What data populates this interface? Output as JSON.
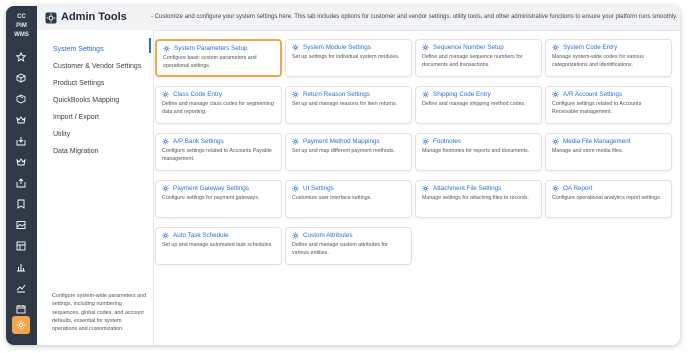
{
  "rail": {
    "brand_lines": [
      "CC",
      "PIM",
      "WMS"
    ],
    "accent_color": "#f2a64a",
    "icons": [
      "star-icon",
      "cube-icon",
      "box-icon",
      "crown-icon",
      "download-box-icon",
      "crown-icon",
      "upload-box-icon",
      "tag-icon",
      "image-icon",
      "table-icon",
      "bar-chart-icon",
      "line-chart-icon",
      "calendar-icon",
      "grid-icon",
      "settings-gear-icon"
    ]
  },
  "header": {
    "title": "Admin Tools",
    "description": "- Customize and configure your system settings here. This tab includes options for customer and vendor settings, utility tools, and other administrative functions to ensure your platform runs smoothly."
  },
  "nav": {
    "items": [
      {
        "label": "System Settings"
      },
      {
        "label": "Customer & Vendor Settings"
      },
      {
        "label": "Product Settings"
      },
      {
        "label": "QuickBooks Mapping"
      },
      {
        "label": "Import / Export"
      },
      {
        "label": "Utility"
      },
      {
        "label": "Data Migration"
      }
    ],
    "help_text": "Configure system-wide parameters and settings, including numbering sequences, global codes, and account defaults, essential for system operations and customization."
  },
  "cards": [
    {
      "title": "System Parameters Setup",
      "desc": "Configure basic system parameters and operational settings."
    },
    {
      "title": "System Module Settings",
      "desc": "Set up settings for individual system modules."
    },
    {
      "title": "Sequence Number Setup",
      "desc": "Define and manage sequence numbers for documents and transactions."
    },
    {
      "title": "System Code Entry",
      "desc": "Manage system-wide codes for various categorizations and identifications."
    },
    {
      "title": "Class Code Entry",
      "desc": "Define and manage class codes for segmenting data and reporting."
    },
    {
      "title": "Return Reason Settings",
      "desc": "Set up and manage reasons for item returns."
    },
    {
      "title": "Shipping Code Entry",
      "desc": "Define and manage shipping method codes."
    },
    {
      "title": "A/R Account Settings",
      "desc": "Configure settings related to Accounts Receivable management."
    },
    {
      "title": "A/P Bank Settings",
      "desc": "Configure settings related to Accounts Payable management."
    },
    {
      "title": "Payment Method Mappings",
      "desc": "Set up and map different payment methods."
    },
    {
      "title": "Footnotes",
      "desc": "Manage footnotes for reports and documents."
    },
    {
      "title": "Media File Management",
      "desc": "Manage and store media files."
    },
    {
      "title": "Payment Gateway Settings",
      "desc": "Configure settings for payment gateways."
    },
    {
      "title": "UI Settings",
      "desc": "Customize user interface settings."
    },
    {
      "title": "Attachment File Settings",
      "desc": "Manage settings for attaching files to records."
    },
    {
      "title": "OA Report",
      "desc": "Configure operational analytics report settings."
    },
    {
      "title": "Auto Task Schedule",
      "desc": "Set up and manage automated task schedules."
    },
    {
      "title": "Custom Attributes",
      "desc": "Define and manage custom attributes for various entities."
    }
  ],
  "colors": {
    "link_blue": "#2a6fd6",
    "selected_border": "#f2a64a",
    "rail_bg": "#2f3a46"
  }
}
